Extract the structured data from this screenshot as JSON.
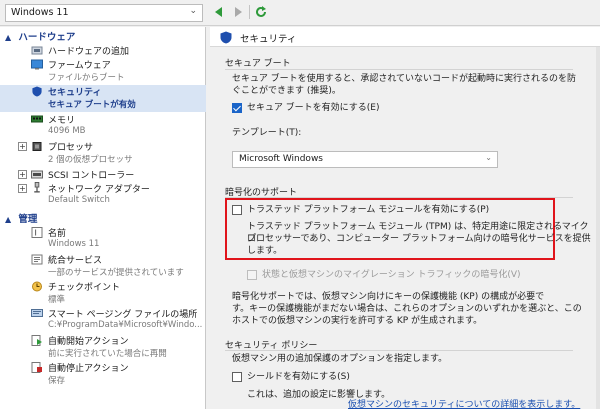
{
  "toolbar": {
    "vm_name": "Windows 11"
  },
  "left_panel": {
    "hardware_header": "ハードウェア",
    "management_header": "管理",
    "hardware_items": [
      {
        "label": "ハードウェアの追加",
        "sub": ""
      },
      {
        "label": "ファームウェア",
        "sub": "ファイルからブート"
      },
      {
        "label": "セキュリティ",
        "sub": "セキュア ブートが有効"
      },
      {
        "label": "メモリ",
        "sub": "4096 MB"
      },
      {
        "label": "プロセッサ",
        "sub": "2 個の仮想プロセッサ"
      },
      {
        "label": "SCSI コントローラー",
        "sub": ""
      },
      {
        "label": "ネットワーク アダプター",
        "sub": "Default Switch"
      }
    ],
    "management_items": [
      {
        "label": "名前",
        "sub": "Windows 11"
      },
      {
        "label": "統合サービス",
        "sub": "一部のサービスが提供されています"
      },
      {
        "label": "チェックポイント",
        "sub": "標準"
      },
      {
        "label": "スマート ページング ファイルの場所",
        "sub": "C:¥ProgramData¥Microsoft¥Windo..."
      },
      {
        "label": "自動開始アクション",
        "sub": "前に実行されていた場合に再開"
      },
      {
        "label": "自動停止アクション",
        "sub": "保存"
      }
    ]
  },
  "right_panel": {
    "title": "セキュリティ",
    "secure_boot": {
      "group_title": "セキュア ブート",
      "description_line1": "セキュア ブートを使用すると、承認されていないコードが起動時に実行されるのを防",
      "description_line2": "ぐことができます (推奨)。",
      "checkbox_label": "セキュア ブートを有効にする(E)",
      "checked": true,
      "template_label": "テンプレート(T):",
      "template_value": "Microsoft Windows"
    },
    "encryption": {
      "group_title": "暗号化のサポート",
      "tpm_checkbox_label": "トラステッド プラットフォーム モジュールを有効にする(P)",
      "tpm_checked": false,
      "tpm_desc_line1": "トラステッド プラットフォーム モジュール (TPM) は、特定用途に限定されるマイクロ",
      "tpm_desc_line2": "プロセッサーであり、コンピューター プラットフォーム向けの暗号化サービスを提供",
      "tpm_desc_line3": "します。",
      "migration_checkbox_label": "状態と仮想マシンのマイグレーション トラフィックの暗号化(V)",
      "kp_line1": "暗号化サポートでは、仮想マシン向けにキーの保護機能 (KP) の構成が必要で",
      "kp_line2": "す。キーの保護機能がまだない場合は、これらのオプションのいずれかを選ぶと、この",
      "kp_line3": "ホストでの仮想マシンの実行を許可する KP が生成されます。"
    },
    "security_policy": {
      "group_title": "セキュリティ ポリシー",
      "description": "仮想マシン用の追加保護のオプションを指定します。",
      "shield_checkbox_label": "シールドを有効にする(S)",
      "shield_checked": false,
      "note": "これは、追加の設定に影響します。"
    },
    "learn_more_link": "仮想マシンのセキュリティについての詳細を表示します。"
  },
  "colors": {
    "accent": "#1f3f8c",
    "highlight_border": "#e0141b",
    "link": "#1a4fb0",
    "checkbox_checked": "#1a64c8"
  }
}
